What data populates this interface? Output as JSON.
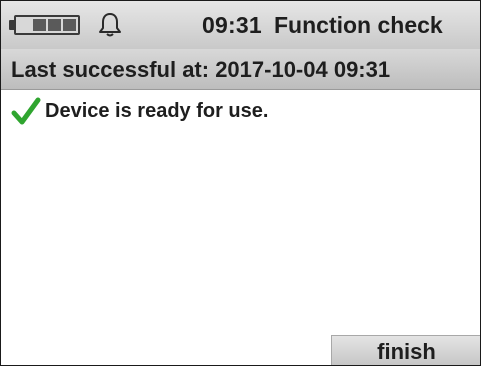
{
  "status_bar": {
    "battery_icon": "battery-icon",
    "battery_level": 0.75,
    "bell_icon": "bell-icon",
    "time": "09:31",
    "title": "Function check"
  },
  "subheader": {
    "label": "Last successful at: 2017-10-04 09:31"
  },
  "content": {
    "status_icon": "checkmark-icon",
    "status_icon_color": "#2fa52f",
    "status_text": "Device is ready for use."
  },
  "footer": {
    "finish_label": "finish"
  }
}
